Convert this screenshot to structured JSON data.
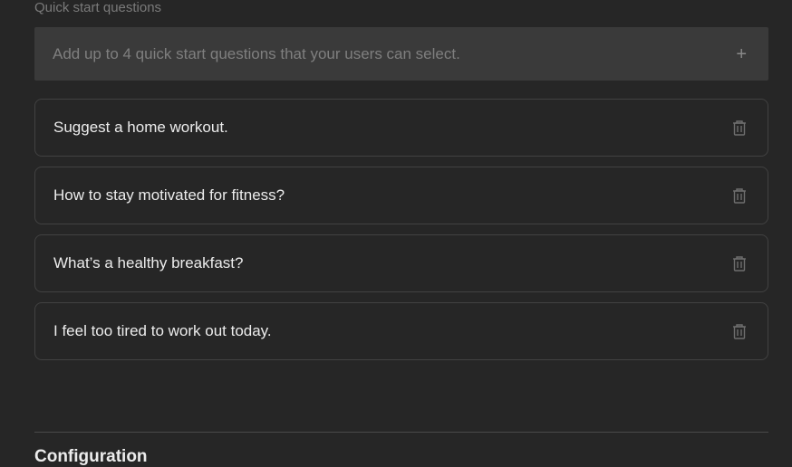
{
  "section": {
    "label": "Quick start questions"
  },
  "add_question": {
    "placeholder": "Add up to 4 quick start questions that your users can select.",
    "icon": "plus-icon"
  },
  "questions": [
    {
      "text": "Suggest a home workout.",
      "icon": "trash-icon"
    },
    {
      "text": "How to stay motivated for fitness?",
      "icon": "trash-icon"
    },
    {
      "text": "What’s a healthy breakfast?",
      "icon": "trash-icon"
    },
    {
      "text": "I feel too tired to work out today.",
      "icon": "trash-icon"
    }
  ],
  "next_section": {
    "title": "Configuration"
  },
  "colors": {
    "background": "#262626",
    "input_background": "#3a3a3a",
    "border": "#424242",
    "text": "#ececec",
    "muted_text": "#7a7a7a"
  }
}
